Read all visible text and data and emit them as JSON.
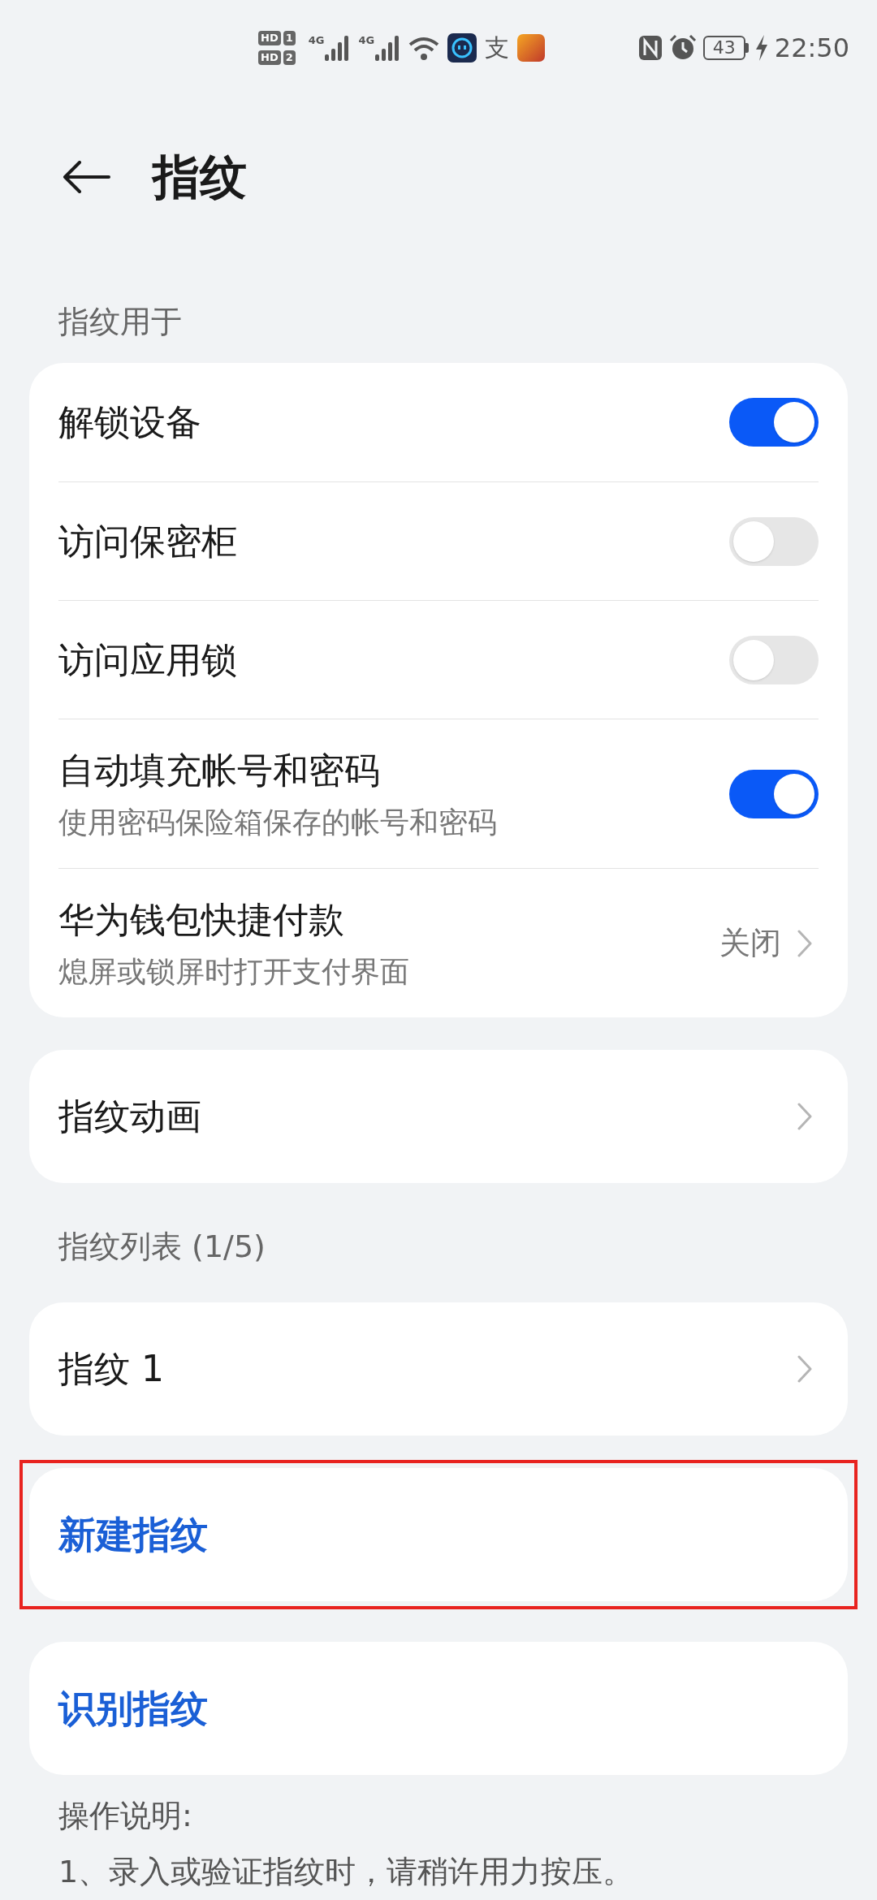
{
  "status_bar": {
    "sims": [
      {
        "badge": "HD",
        "slot": "1"
      },
      {
        "badge": "HD",
        "slot": "2"
      }
    ],
    "networks": [
      "4G",
      "4G"
    ],
    "pay_glyph": "支",
    "battery": "43",
    "time": "22:50"
  },
  "header": {
    "title": "指纹"
  },
  "blocks": [
    {
      "kind": "label",
      "text": "指纹用于"
    },
    {
      "kind": "card",
      "rows": [
        {
          "kind": "toggle",
          "title": "解锁设备",
          "on": true
        },
        {
          "kind": "toggle",
          "title": "访问保密柜",
          "on": false
        },
        {
          "kind": "toggle",
          "title": "访问应用锁",
          "on": false
        },
        {
          "kind": "toggle",
          "title": "自动填充帐号和密码",
          "subtitle": "使用密码保险箱保存的帐号和密码",
          "on": true
        },
        {
          "kind": "link",
          "title": "华为钱包快捷付款",
          "subtitle": "熄屏或锁屏时打开支付界面",
          "value": "关闭"
        }
      ]
    },
    {
      "kind": "card",
      "rows": [
        {
          "kind": "link",
          "title": "指纹动画"
        }
      ]
    },
    {
      "kind": "label",
      "text": "指纹列表 (1/5)"
    },
    {
      "kind": "card",
      "rows": [
        {
          "kind": "link",
          "title": "指纹 1"
        }
      ]
    },
    {
      "kind": "card",
      "highlighted": true,
      "rows": [
        {
          "kind": "action",
          "title": "新建指纹"
        }
      ]
    },
    {
      "kind": "card",
      "rows": [
        {
          "kind": "action",
          "title": "识别指纹"
        }
      ]
    }
  ],
  "notes": [
    "操作说明:",
    "1、录入或验证指纹时，请稍许用力按压。"
  ]
}
